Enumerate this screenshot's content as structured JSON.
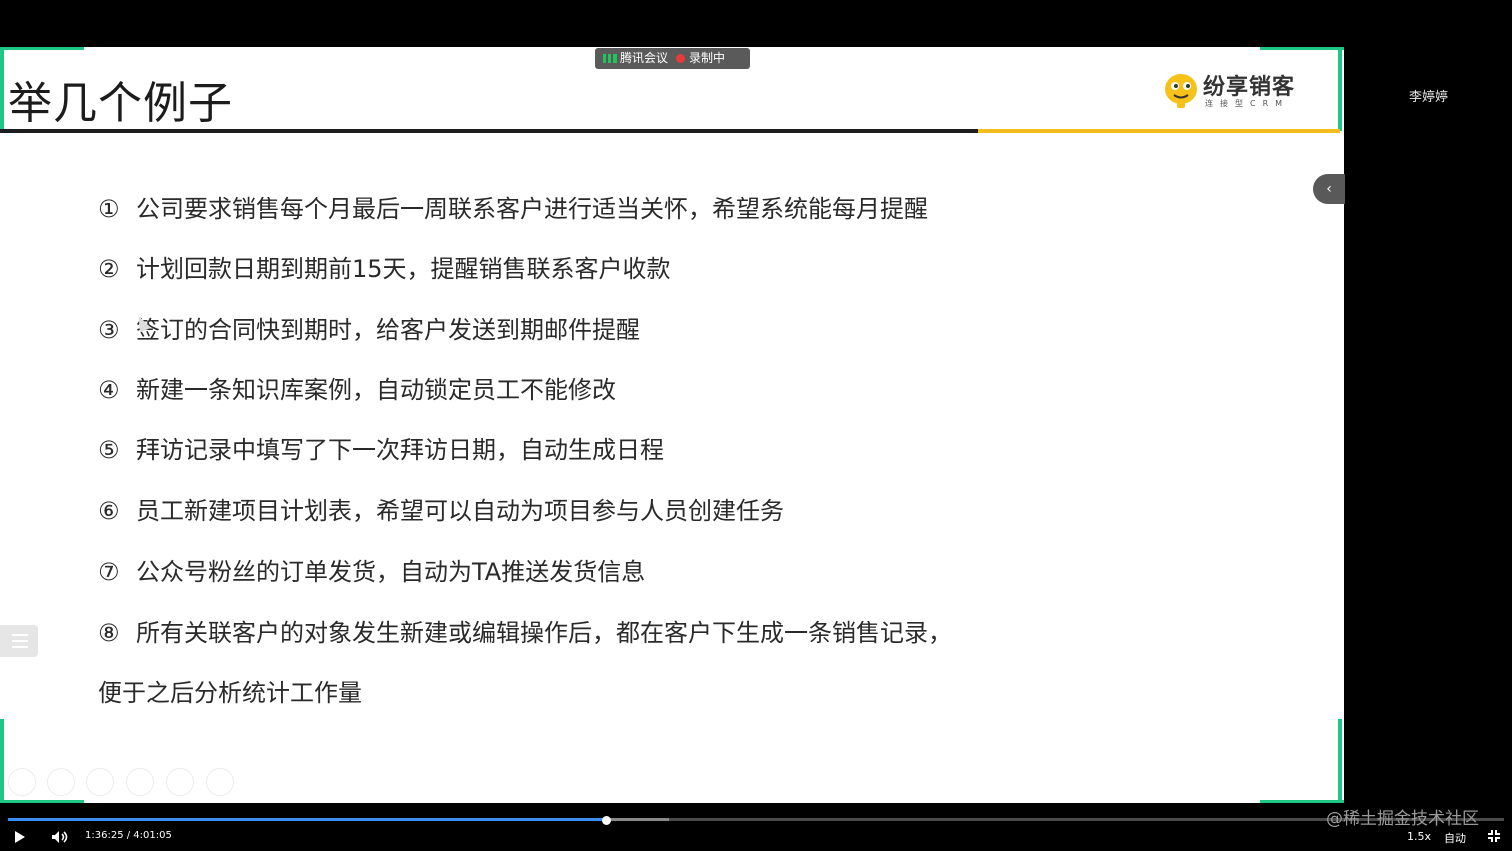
{
  "slide": {
    "title": "举几个例子",
    "logo_text": "纷享销客",
    "logo_sub": "连接型CRM",
    "items": [
      {
        "num": "①",
        "text": "公司要求销售每个月最后一周联系客户进行适当关怀，希望系统能每月提醒"
      },
      {
        "num": "②",
        "text": "计划回款日期到期前15天，提醒销售联系客户收款"
      },
      {
        "num": "③",
        "text": "签订的合同快到期时，给客户发送到期邮件提醒"
      },
      {
        "num": "④",
        "text": "新建一条知识库案例，自动锁定员工不能修改"
      },
      {
        "num": "⑤",
        "text": "拜访记录中填写了下一次拜访日期，自动生成日程"
      },
      {
        "num": "⑥",
        "text": "员工新建项目计划表，希望可以自动为项目参与人员创建任务"
      },
      {
        "num": "⑦",
        "text": "公众号粉丝的订单发货，自动为TA推送发货信息"
      },
      {
        "num": "⑧",
        "text": "所有关联客户的对象发生新建或编辑操作后，都在客户下生成一条销售记录，"
      }
    ],
    "continuation": "便于之后分析统计工作量"
  },
  "meeting": {
    "app_label": "腾讯会议",
    "recording_label": "录制中",
    "participant": "李婷婷",
    "collapse_glyph": "‹"
  },
  "player": {
    "time": "1:36:25 / 4:01:05",
    "progress": 0.4,
    "speed": "1.5x",
    "quality": "自动"
  },
  "watermark": "@稀土掘金技术社区",
  "colors": {
    "accent_green": "#1ec783",
    "accent_gold": "#f2bd1d",
    "progress_blue": "#3a8ef5"
  }
}
